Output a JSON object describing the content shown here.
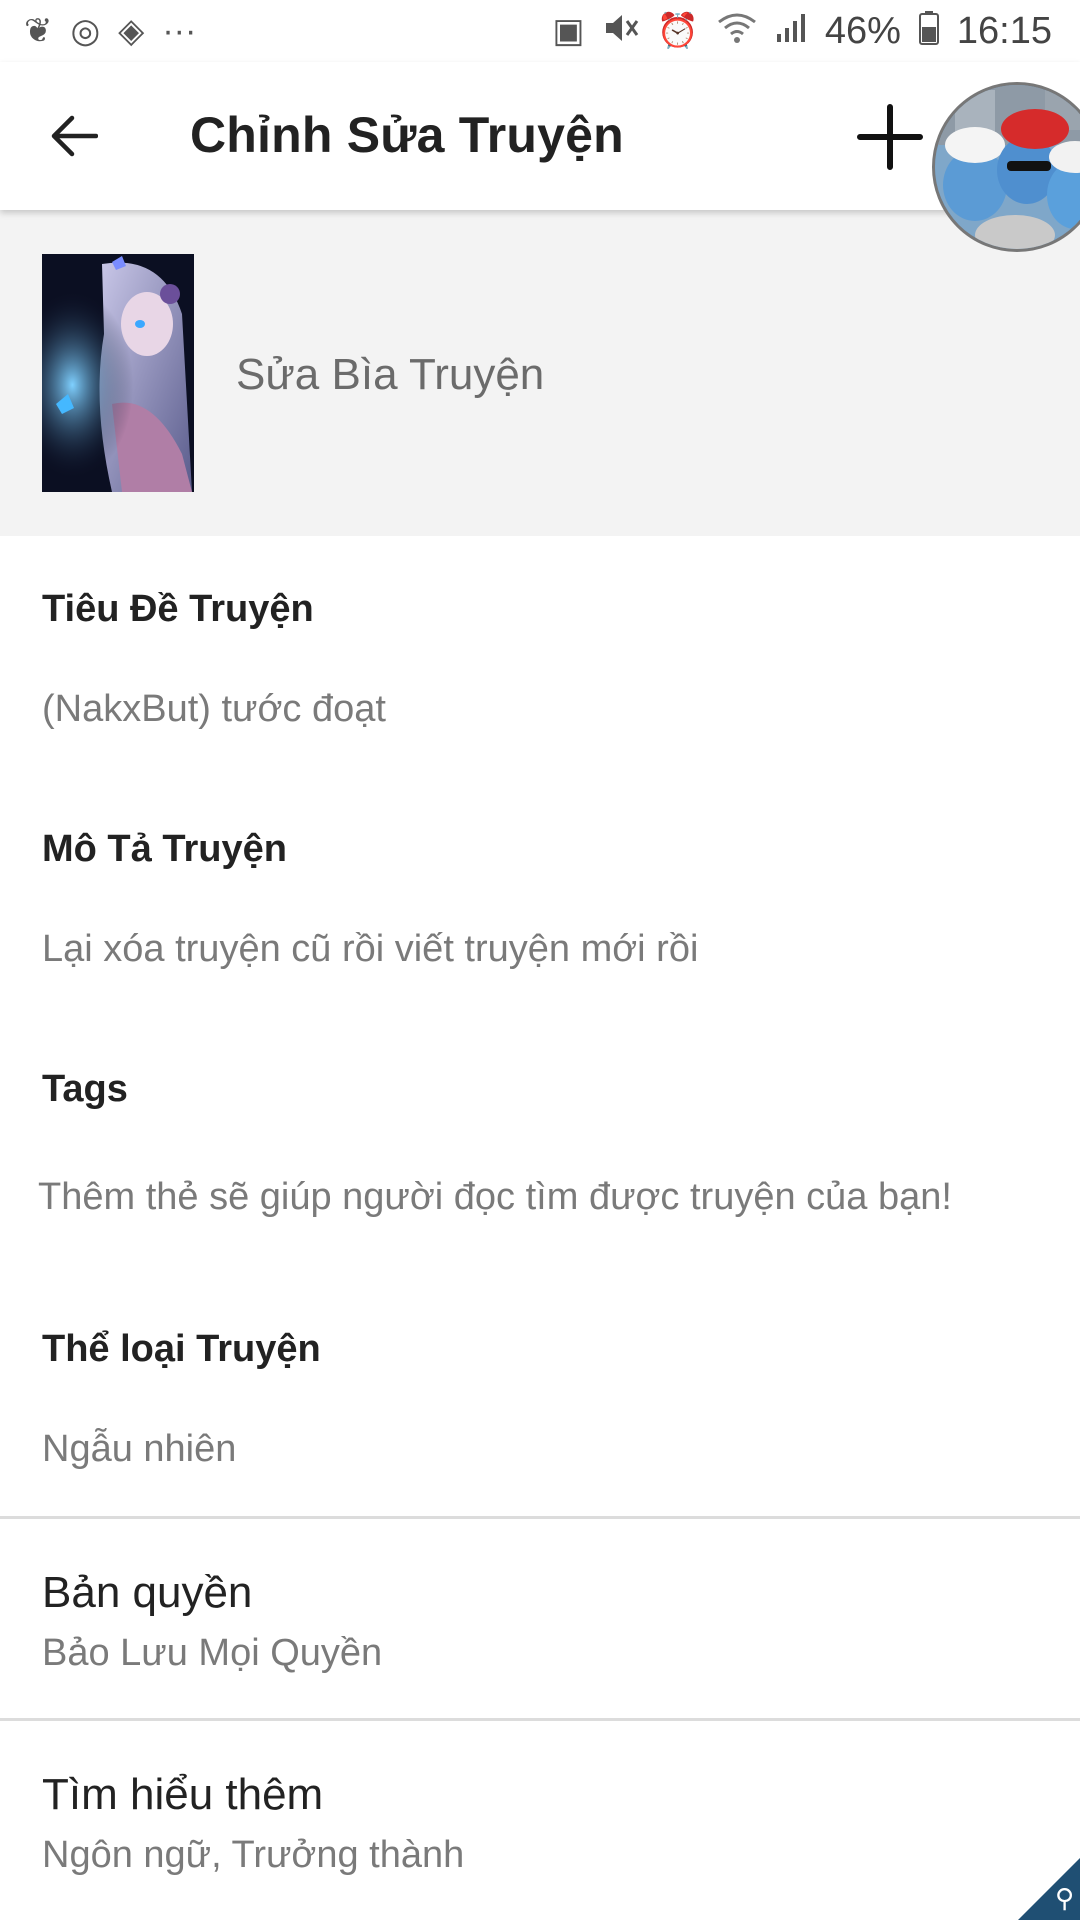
{
  "status_bar": {
    "battery": "46%",
    "time": "16:15",
    "left_icons": [
      "notification-icon",
      "sync-icon",
      "app-icon",
      "more-icon"
    ],
    "right_icons": [
      "battery-saver-icon",
      "mute-icon",
      "alarm-icon",
      "wifi-icon",
      "signal-icon",
      "battery-icon"
    ]
  },
  "app_bar": {
    "title": "Chỉnh Sửa Truyện"
  },
  "cover": {
    "label": "Sửa Bìa Truyện"
  },
  "fields": [
    {
      "label": "Tiêu Đề Truyện",
      "value": "(NakxBut) tước đoạt"
    },
    {
      "label": "Mô Tả Truyện",
      "value": "Lại xóa truyện cũ rồi viết truyện mới rồi"
    },
    {
      "label": "Tags",
      "value": "Thêm thẻ sẽ giúp người đọc tìm được truyện của bạn!"
    },
    {
      "label": "Thể loại Truyện",
      "value": "Ngẫu nhiên"
    }
  ],
  "rows": [
    {
      "title": "Bản quyền",
      "subtitle": "Bảo Lưu Mọi Quyền"
    },
    {
      "title": "Tìm hiểu thêm",
      "subtitle": "Ngôn ngữ, Trưởng thành"
    }
  ],
  "colors": {
    "accent": "#1f4f73",
    "label": "#222222",
    "value": "#7a7a7a",
    "cover_bg": "#f3f3f3"
  }
}
